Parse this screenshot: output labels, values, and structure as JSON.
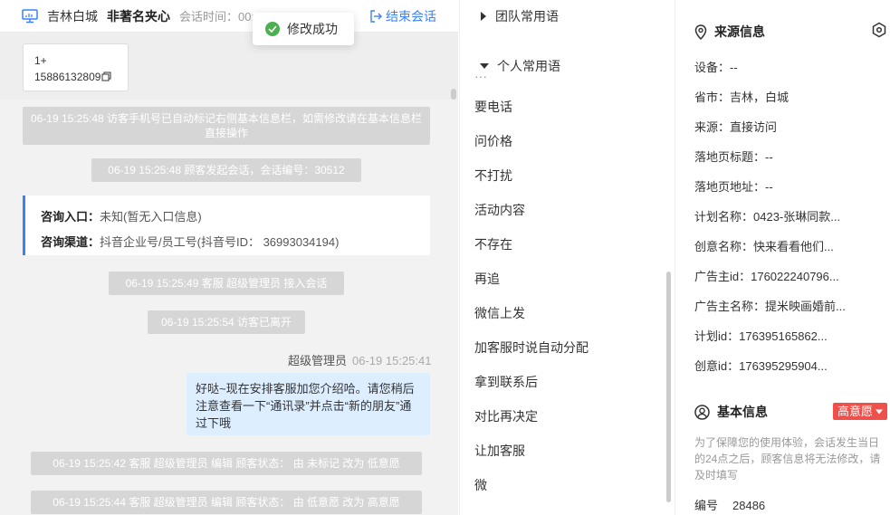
{
  "header": {
    "region": "吉林白城",
    "visitor_name": "非著名夹心",
    "session_time_label": "会话时间：00:00:48",
    "end_session": "结束会话"
  },
  "toast": {
    "message": "修改成功"
  },
  "phone_card": {
    "line1": "1+",
    "line2": "15886132809"
  },
  "chat": {
    "system_messages": [
      {
        "text": "06-19 15:25:48 访客手机号已自动标记右侧基本信息栏，如需修改请在基本信息栏直接操作"
      },
      {
        "text": "06-19 15:25:48 顾客发起会话，会话编号：30512"
      },
      {
        "text": "06-19 15:25:49 客服 超级管理员 接入会话"
      },
      {
        "text": "06-19 15:25:54 访客已离开"
      },
      {
        "text": "06-19 15:25:42 客服 超级管理员 编辑 顾客状态： 由 未标记 改为 低意愿"
      },
      {
        "text": "06-19 15:25:44 客服 超级管理员 编辑 顾客状态： 由 低意愿 改为 高意愿"
      }
    ],
    "entry_card": {
      "entry_label": "咨询入口：",
      "entry_value": "未知(暂无入口信息)",
      "channel_label": "咨询渠道：",
      "channel_value": "抖音企业号/员工号(抖音号ID： 36993034194)"
    },
    "agent_message": {
      "sender": "超级管理员",
      "time": "06-19 15:25:41",
      "text": "好哒~现在安排客服加您介绍哈。请您稍后注意查看一下“通讯录”并点击“新的朋友”通过下哦"
    }
  },
  "phrases": {
    "team_group": "团队常用语",
    "personal_group": "个人常用语",
    "items": [
      "要电话",
      "问价格",
      "不打扰",
      "活动内容",
      "不存在",
      "再追",
      "微信上发",
      "加客服时说自动分配",
      "拿到联系后",
      "对比再决定",
      "让加客服",
      "微"
    ]
  },
  "source_info": {
    "title": "来源信息",
    "rows": [
      {
        "text": "设备：--"
      },
      {
        "text": "省市：吉林，白城"
      },
      {
        "text": "来源：直接访问"
      },
      {
        "text": "落地页标题：--"
      },
      {
        "text": "落地页地址：--"
      },
      {
        "text": "计划名称：0423-张琳同款..."
      },
      {
        "text": "创意名称：快来看看他们..."
      },
      {
        "text": "广告主id：176022240796..."
      },
      {
        "text": "广告主名称：提米映画婚前..."
      },
      {
        "text": "计划id：176395165862..."
      },
      {
        "text": "创意id：176395295904..."
      }
    ]
  },
  "basic_info": {
    "title": "基本信息",
    "intent_badge": "高意愿",
    "notice": "为了保障您的使用体验，会话发生当日的24点之后，顾客信息将无法修改，请及时填写",
    "id_label": "编号",
    "id_value": "28486"
  },
  "colors": {
    "accent_blue": "#3b82f6",
    "badge_red": "#f0504a",
    "toast_green": "#4caf50"
  }
}
